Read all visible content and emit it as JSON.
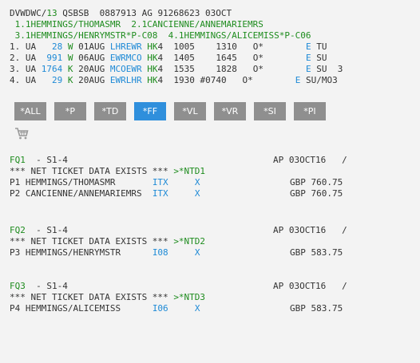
{
  "header": {
    "prefix": "DVWDWC/",
    "agent": "13",
    "rest": " QSBSB  0887913 AG 91268623 03OCT"
  },
  "names": [
    " 1.1HEMMINGS/THOMASMR  2.1CANCIENNE/ANNEMARIEMRS",
    " 3.1HEMMINGS/HENRYMSTR*P-C08  4.1HEMMINGS/ALICEMISS*P-C06"
  ],
  "segments": [
    {
      "num": "1.",
      "carrier": "UA",
      "flight": "  28",
      "cls": "W",
      "date": "01AUG",
      "route": "LHREWR",
      "status": "HK",
      "qty": "4",
      "dep": "  1005",
      "arr": "    1310",
      "mark": "   O*",
      "e": "E",
      "day": " TU"
    },
    {
      "num": "2.",
      "carrier": "UA",
      "flight": " 991",
      "cls": "W",
      "date": "06AUG",
      "route": "EWRMCO",
      "status": "HK",
      "qty": "4",
      "dep": "  1405",
      "arr": "    1645",
      "mark": "   O*",
      "e": "E",
      "day": " SU"
    },
    {
      "num": "3.",
      "carrier": "UA",
      "flight": "1764",
      "cls": "K",
      "date": "20AUG",
      "route": "MCOEWR",
      "status": "HK",
      "qty": "4",
      "dep": "  1535",
      "arr": "    1828",
      "mark": "   O*",
      "e": "E",
      "day": " SU  3"
    },
    {
      "num": "4.",
      "carrier": "UA",
      "flight": "  29",
      "cls": "K",
      "date": "20AUG",
      "route": "EWRLHR",
      "status": "HK",
      "qty": "4",
      "dep": "  1930",
      "arr": " #0740",
      "mark": "   O*",
      "e": "E",
      "day": " SU/MO3"
    }
  ],
  "toolbar": {
    "buttons": [
      "*ALL",
      "*P",
      "*TD",
      "*FF",
      "*VL",
      "*VR",
      "*SI",
      "*PI"
    ],
    "active": "*FF"
  },
  "fare_quotes": [
    {
      "label": "FQ1",
      "segs": "  - S1-4",
      "ap": "AP 03OCT16   /",
      "net_text": "*** NET TICKET DATA EXISTS *** ",
      "net_link": ">*NTD1",
      "passengers": [
        {
          "pax": "P1 HEMMINGS/THOMASMR       ",
          "code": "ITX",
          "x": "X",
          "amount": "GBP 760.75"
        },
        {
          "pax": "P2 CANCIENNE/ANNEMARIEMRS  ",
          "code": "ITX",
          "x": "X",
          "amount": "GBP 760.75"
        }
      ]
    },
    {
      "label": "FQ2",
      "segs": "  - S1-4",
      "ap": "AP 03OCT16   /",
      "net_text": "*** NET TICKET DATA EXISTS *** ",
      "net_link": ">*NTD2",
      "passengers": [
        {
          "pax": "P3 HEMMINGS/HENRYMSTR      ",
          "code": "I08",
          "x": "X",
          "amount": "GBP 583.75"
        }
      ]
    },
    {
      "label": "FQ3",
      "segs": "  - S1-4",
      "ap": "AP 03OCT16   /",
      "net_text": "*** NET TICKET DATA EXISTS *** ",
      "net_link": ">*NTD3",
      "passengers": [
        {
          "pax": "P4 HEMMINGS/ALICEMISS      ",
          "code": "I06",
          "x": "X",
          "amount": "GBP 583.75"
        }
      ]
    }
  ],
  "icons": {
    "cart": "shopping-cart-icon"
  },
  "colors": {
    "green": "#1e8c1e",
    "blue": "#1e8ad6",
    "button": "#8f8f8f",
    "button_active": "#2f8fdc",
    "background": "#f3f3f3"
  }
}
